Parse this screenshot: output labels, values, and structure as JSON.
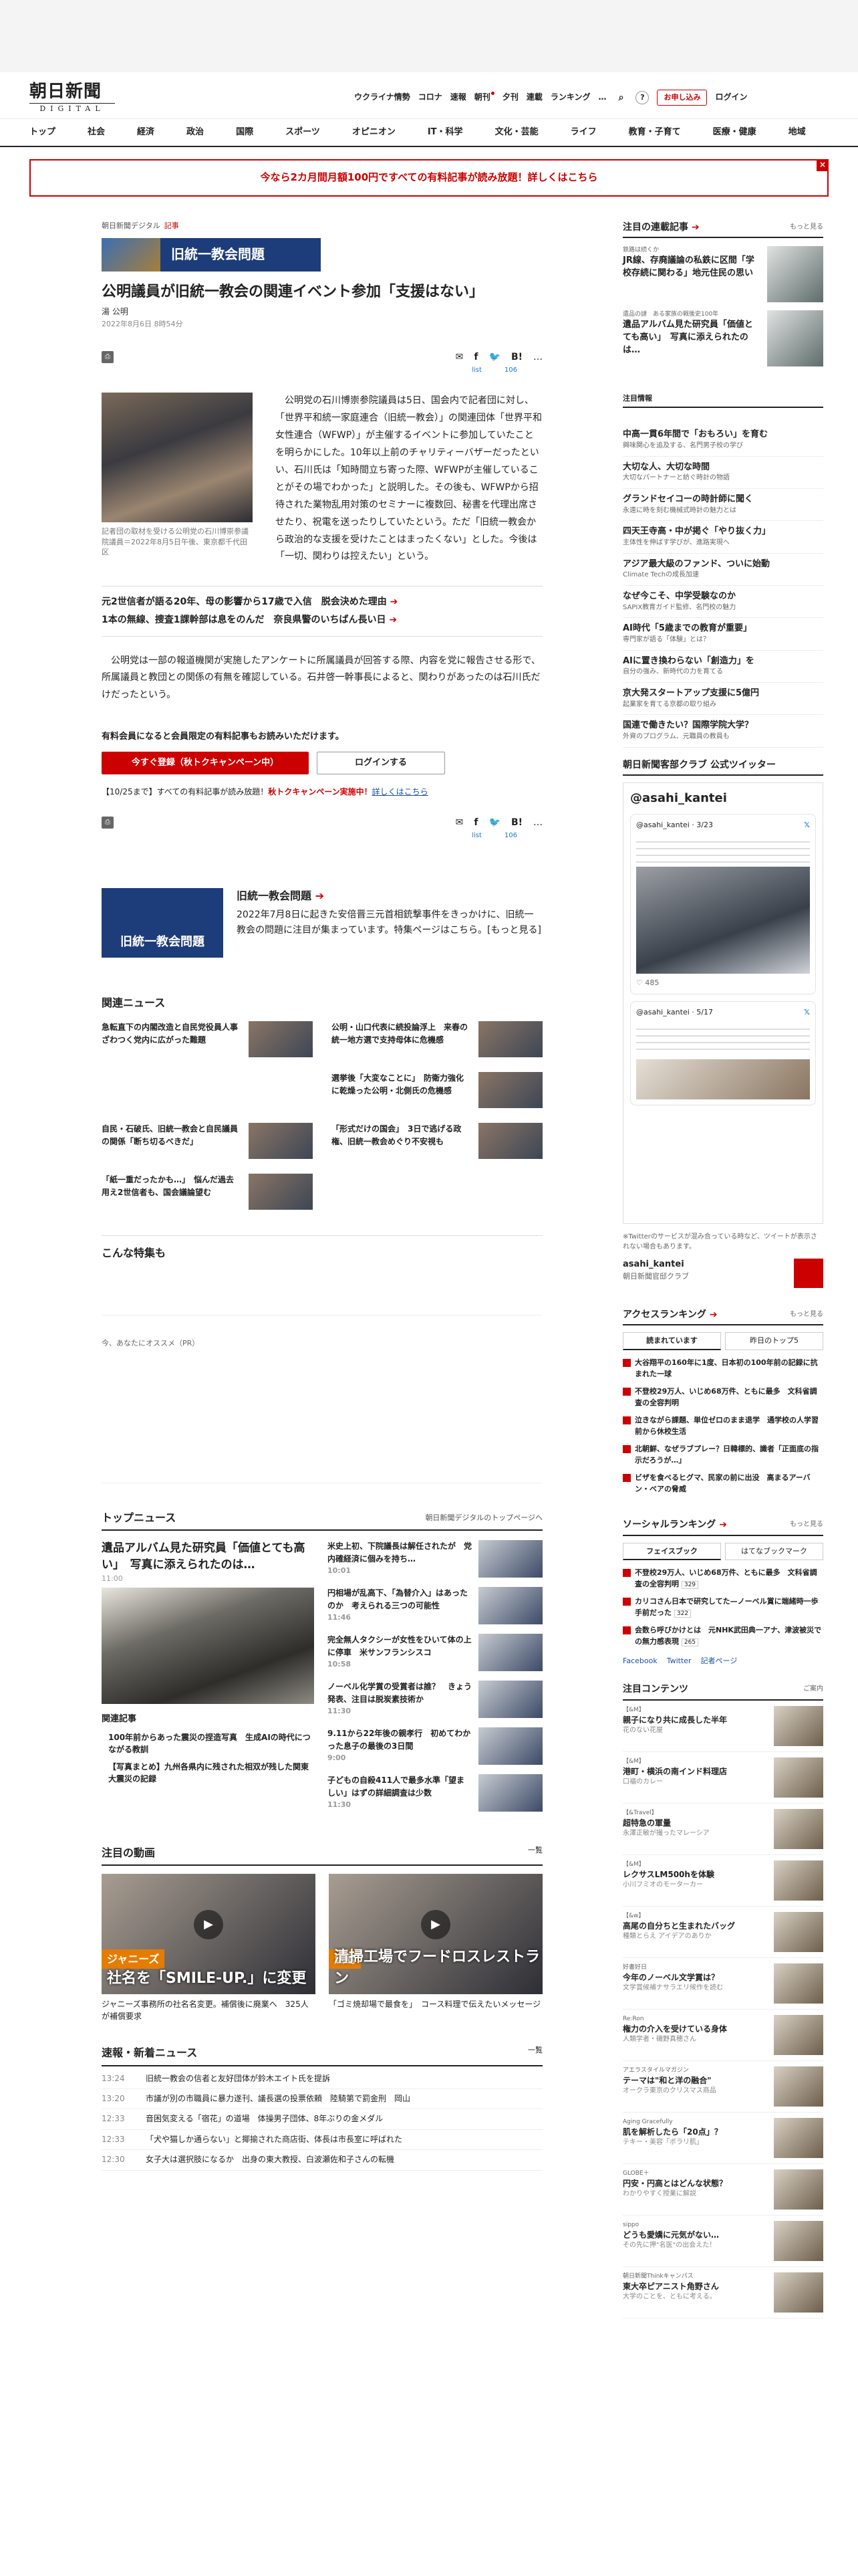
{
  "site": {
    "logo_main": "朝日新聞",
    "logo_sub": "DIGITAL"
  },
  "util_nav": [
    "ウクライナ情勢",
    "コロナ",
    "速報",
    "朝刊",
    "夕刊",
    "連載",
    "ランキング",
    "…"
  ],
  "util_buttons": {
    "register": "お申し込み",
    "login": "ログイン"
  },
  "global_nav": [
    "トップ",
    "社会",
    "経済",
    "政治",
    "国際",
    "スポーツ",
    "オピニオン",
    "IT・科学",
    "文化・芸能",
    "ライフ",
    "教育・子育て",
    "医療・健康",
    "地域"
  ],
  "banner": {
    "text": "今なら2カ月間月額100円ですべての有料記事が読み放題！詳しくはこちら",
    "close": "×"
  },
  "article": {
    "crumb_site": "朝日新聞デジタル",
    "crumb_section": "記事",
    "topic_banner": "旧統一教会問題",
    "title": "公明議員が旧統一教会の関連イベント参加「支援はない」",
    "author": "湯 公明",
    "date": "2022年8月6日 8時54分",
    "likes": [
      "list",
      "106"
    ],
    "photo_caption": "記者団の取材を受ける公明党の石川博崇参議院議員＝2022年8月5日午後、東京都千代田区",
    "body1": "公明党の石川博崇参院議員は5日、国会内で記者団に対し、「世界平和統一家庭連合（旧統一教会）」の関連団体「世界平和女性連合（WFWP）」が主催するイベントに参加していたことを明らかにした。10年以上前のチャリティーバザーだったといい、石川氏は「知時間立ち寄った際、WFWPが主催していることがその場でわかった」と説明した。その後も、WFWPから招待された業物乱用対策のセミナーに複数回、秘書を代理出席させたり、祝電を送ったりしていたという。ただ「旧統一教会から政治的な支援を受けたことはまったくない」とした。今後は「一切、関わりは控えたい」という。",
    "related_links": [
      "元2世信者が語る20年、母の影響から17歳で入信　脱会決めた理由",
      "1本の無線、捜査1課幹部は息をのんだ　奈良県警のいちばん長い日"
    ],
    "body2": "公明党は一部の報道機関が実施したアンケートに所属議員が回答する際、内容を党に報告させる形で、所属議員と教団との関係の有無を確認している。石井啓一幹事長によると、関わりがあったのは石川氏だけだったという。",
    "member_note": "有料会員になると会員限定の有料記事もお読みいただけます。",
    "btn_register": "今すぐ登録（秋トクキャンペーン中）",
    "btn_login": "ログインする",
    "campaign_date": "【10/25まで】すべての有料記事が読み放題！",
    "campaign_red": "秋トクキャンペーン実施中！",
    "campaign_link": "詳しくはこちら"
  },
  "special": {
    "image_label": "旧統一教会問題",
    "title": "旧統一教会問題",
    "text": "2022年7月8日に起きた安倍晋三元首相銃撃事件をきっかけに、旧統一教会の問題に注目が集まっています。特集ページはこちら。[もっと見る]"
  },
  "related_news": {
    "heading": "関連ニュース",
    "items": [
      "急転直下の内閣改造と自民党役員人事　ざわつく党内に広がった難題",
      "公明・山口代表に続投論浮上　来春の統一地方選で支持母体に危機感",
      "",
      "選挙後「大変なことに」　防衛力強化に乾燥った公明・北側氏の危機感",
      "自民・石破氏、旧統一教会と自民議員の関係「断ち切るべきだ」",
      "「形式だけの国会」　3日で逃げる政権、旧統一教会めぐり不安視も",
      "「紙一重だったかも…」　悩んだ過去用え2世信者も、国会議論望む"
    ]
  },
  "konna": {
    "heading": "こんな特集も"
  },
  "pr_label": "今、あなたにオススメ（PR）",
  "top_news": {
    "heading": "トップニュース",
    "more": "朝日新聞デジタルのトップページへ",
    "main_title": "遺品アルバム見た研究員「価値とても高い」　写真に添えられたのは…",
    "main_time": "11:00",
    "related_heading": "関連記事",
    "related": [
      "100年前からあった震災の捏造写真　生成AIの時代につながる教訓",
      "【写真まとめ】九州各県内に残された相双が残した関東大震災の記録"
    ],
    "items": [
      {
        "title": "米史上初、下院議長は解任されたが　党内確経済に個みを持ち…",
        "time": "10:01"
      },
      {
        "title": "円相場が乱高下、「為替介入」はあったのか　考えられる三つの可能性",
        "time": "11:46"
      },
      {
        "title": "完全無人タクシーが女性をひいて体の上に停車　米サンフランシスコ",
        "time": "10:58"
      },
      {
        "title": "ノーベル化学賞の受賞者は誰？　きょう発表、注目は脱炭素技術か",
        "time": "11:30"
      },
      {
        "title": "9.11から22年後の親孝行　初めてわかった息子の最後の3日間",
        "time": "9:00"
      },
      {
        "title": "子どもの自殺411人で最多水準「望ましい」はずの詳細調査は少数",
        "time": "11:30"
      }
    ]
  },
  "videos": {
    "heading": "注目の動画",
    "more": "一覧",
    "items": [
      {
        "badge": "ジャニーズ",
        "caption": "社名を「SMILE-UP.」に変更",
        "title": "ジャニーズ事務所の社名名変更。補償後に廃業へ　325人が補償要求"
      },
      {
        "badge": "広島",
        "caption": "清掃工場でフードロスレストラン",
        "title": "「ゴミ焼却場で最食を」　コース料理で伝えたいメッセージ"
      }
    ]
  },
  "breaking": {
    "heading": "速報・新着ニュース",
    "more": "一覧",
    "items": [
      {
        "time": "13:24",
        "title": "旧統一教会の信者と友好団体が鈴木エイト氏を提訴"
      },
      {
        "time": "13:20",
        "title": "市議が別の市職員に暴力遂刊、議長選の投票依頼　陸騎第で罰金刑　岡山"
      },
      {
        "time": "12:33",
        "title": "音困気変える「宿花」の道場　体操男子団体、8年ぶりの金メダル"
      },
      {
        "time": "12:33",
        "title": "「犬や猫しか通らない」と揶揄された商店街、体長は市長室に呼ばれた"
      },
      {
        "time": "12:30",
        "title": "女子大は選択肢になるか　出身の東大教授、白波瀬佐和子さんの転機"
      }
    ]
  },
  "side": {
    "feature_heading": "注目の連載記事",
    "feature_more": "もっと見る",
    "features": [
      {
        "label": "鉄路は続くか",
        "title": "JR線、存廃議論の私鉄に区間「学校存続に関わる」地元住民の思い"
      },
      {
        "label": "遺品の謎　ある家族の戦後史100年",
        "title": "遺品アルバム見た研究員「価値とても高い」　写真に添えられたのは…"
      }
    ],
    "hot_heading": "注目情報",
    "hot": [
      {
        "title": "中高一貫6年間で「おもろい」を育む",
        "sub": "興味関心を追及する、名門男子校の学び"
      },
      {
        "title": "大切な人、大切な時間",
        "sub": "大切なパートナーと紡ぐ時計の物語"
      },
      {
        "title": "グランドセイコーの時計師に聞く",
        "sub": "永遠に時を刻む機械式時計の魅力とは"
      },
      {
        "title": "四天王寺高・中が掲ぐ「やり抜く力」",
        "sub": "主体性を伸ばす学びが、進路実現へ"
      },
      {
        "title": "アジア最大級のファンド、ついに始動",
        "sub": "Climate Techの成長加速"
      },
      {
        "title": "なぜ今こそ、中学受験なのか",
        "sub": "SAPIX教育ガイド監修、名門校の魅力"
      },
      {
        "title": "AI時代「5歳までの教育が重要」",
        "sub": "専門家が語る「体験」とは？"
      },
      {
        "title": "AIに置き換わらない「創造力」を",
        "sub": "自分の強み、新時代の力を育てる"
      },
      {
        "title": "京大発スタートアップ支援に5億円",
        "sub": "起業家を育てる京都の取り組み"
      },
      {
        "title": "国連で働きたい？国際学院大学？",
        "sub": "外資のプログラム、元職員の教員も"
      }
    ],
    "twitter_heading": "朝日新聞客部クラブ 公式ツイッター",
    "twitter_handle": "@asahi_kantei",
    "tweet_user": "@asahi_kantei · 3/23",
    "tweet_user2": "@asahi_kantei · 5/17",
    "tweet_stats": "485",
    "twitter_note": "※Twitterのサービスが混み合っている時など、ツイートが表示されない場合もあります。",
    "twitter_account": "asahi_kantei",
    "twitter_account_sub": "朝日新聞官邸クラブ",
    "access_heading": "アクセスランキング",
    "access_more": "もっと見る",
    "access_tabs": [
      "読まれています",
      "昨日のトップ5"
    ],
    "access": [
      "大谷翔平の160年に1度、日本初の100年前の記録に抗まれた一球",
      "不登校29万人、いじめ68万件、ともに最多　文科省調査の全容判明",
      "泣きながら課題、単位ゼロのまま退学　通学校の人学習前から休校生活",
      "北朝鮮、なぜラブプレー？日韓標的、識者「正面底の指示だろうが…」",
      "ビザを食べるヒグマ、民家の前に出没　高まるアーバン・ベアの脅威"
    ],
    "social_heading": "ソーシャルランキング",
    "social_more": "もっと見る",
    "social_tabs": [
      "フェイスブック",
      "はてなブックマーク"
    ],
    "social": [
      {
        "title": "不登校29万人、いじめ68万件、ともに最多　文科省調査の全容判明",
        "count": "329"
      },
      {
        "title": "カリコさん日本で研究してた—ノーベル賞に端緒時一歩手前だった",
        "count": "322"
      },
      {
        "title": "会数ら呼びかけとは　元NHK武田典一アナ、津波被災での無力感表現",
        "count": "265"
      }
    ],
    "share_links": [
      "Facebook",
      "Twitter",
      "記者ページ"
    ],
    "contents_heading": "注目コンテンツ",
    "contents_more": "ご案内",
    "contents": [
      {
        "label": "【&M】",
        "title": "親子になり共に成長した半年",
        "sub": "花のない花屋"
      },
      {
        "label": "【&M】",
        "title": "港町・横浜の南インド料理店",
        "sub": "口福のカレー"
      },
      {
        "label": "【&Travel】",
        "title": "超特急の軍量",
        "sub": "永澤正敏が撮ったマレーシア"
      },
      {
        "label": "【&M】",
        "title": "レクサスLM500hを体験",
        "sub": "小川フミオのモーターカー"
      },
      {
        "label": "【&w】",
        "title": "高尾の自分ちと生まれたバッグ",
        "sub": "種類とらえ アイデアのありか"
      },
      {
        "label": "好書好日",
        "title": "今年のノーベル文学賞は？",
        "sub": "文学賞候補ナサラエリ候作を読む"
      },
      {
        "label": "Re:Ron",
        "title": "権力の介入を受けている身体",
        "sub": "人類学者・磯野真穂さん"
      },
      {
        "label": "アエラスタイルマガジン",
        "title": "テーマは\"和と洋の融合\"",
        "sub": "オークラ東京のクリスマス商品"
      },
      {
        "label": "Aging Gracefully",
        "title": "肌を解析したら「20点」？",
        "sub": "テキー・美容「ボラリ肌」"
      },
      {
        "label": "GLOBE＋",
        "title": "円安・円高とはどんな状態？",
        "sub": "わかりやすく授業に解説"
      },
      {
        "label": "sippo",
        "title": "どうも愛嬌に元気がない…",
        "sub": "その先に押\"名医\"の出会えた！"
      },
      {
        "label": "朝日新聞Thinkキャンパス",
        "title": "東大卒ピアニスト角野さん",
        "sub": "大学のことを、ともに考える。"
      }
    ]
  }
}
